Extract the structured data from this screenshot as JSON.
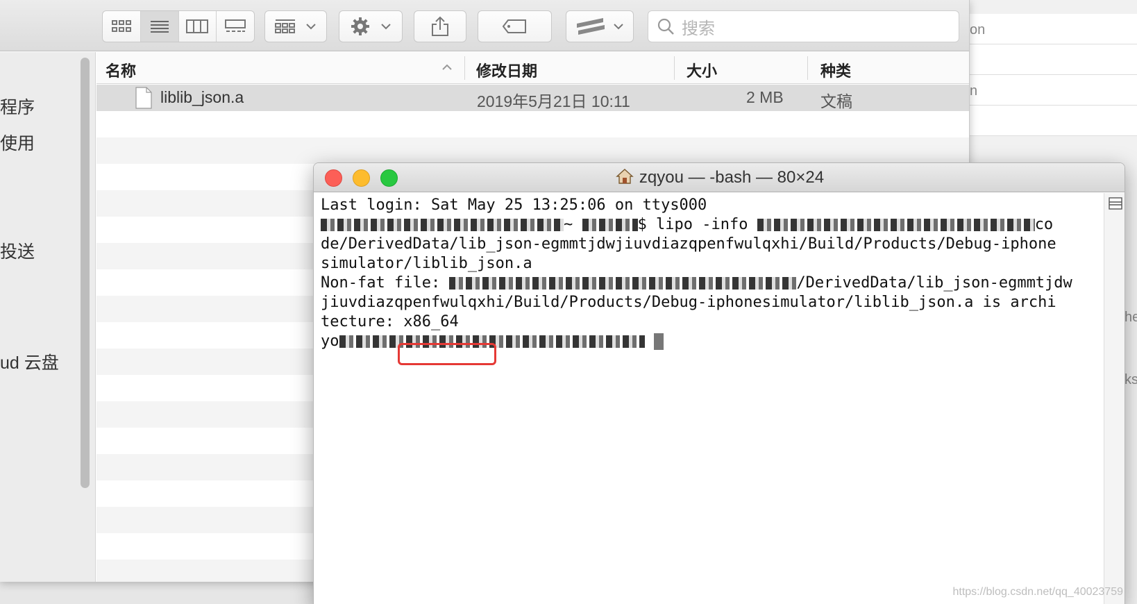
{
  "background_window": {
    "fragments": [
      "on",
      "n",
      "he",
      "ks"
    ]
  },
  "finder": {
    "search_placeholder": "搜索",
    "sidebar_items": [
      "程序",
      "使用",
      "投送",
      "ud 云盘"
    ],
    "columns": {
      "name": "名称",
      "date": "修改日期",
      "size": "大小",
      "kind": "种类"
    },
    "files": [
      {
        "name": "liblib_json.a",
        "date": "2019年5月21日 10:11",
        "size": "2 MB",
        "kind": "文稿"
      }
    ]
  },
  "terminal": {
    "title": "zqyou — -bash — 80×24",
    "lines": {
      "l1": "Last login: Sat May 25 13:25:06 on ttys000",
      "l2_cmd": "~ ",
      "l2_cmd2": "$ lipo -info ",
      "l2_end": "co",
      "l3": "de/DerivedData/lib_json-egmmtjdwjiuvdiazqpenfwulqxhi/Build/Products/Debug-iphone",
      "l4": "simulator/liblib_json.a",
      "l5_pre": "Non-fat file: ",
      "l5_post": "/DerivedData/lib_json-egmmtjdw",
      "l6": "jiuvdiazqpenfwulqxhi/Build/Products/Debug-iphonesimulator/liblib_json.a is archi",
      "l7_pre": "tecture: ",
      "l7_arch": "x86_64",
      "l8_pre": "yo"
    }
  },
  "watermark": "https://blog.csdn.net/qq_40023759",
  "colors": {
    "close": "#fc5f57",
    "minimize": "#fdbc2e",
    "zoom": "#28c840",
    "highlight": "#e53935"
  }
}
